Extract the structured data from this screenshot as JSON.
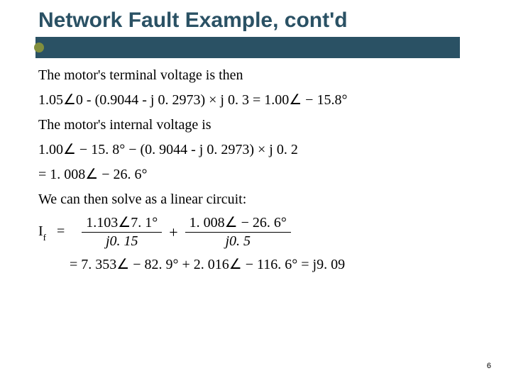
{
  "slide": {
    "title": "Network Fault Example, cont'd",
    "page_number": "6"
  },
  "body": {
    "line1": "The motor's terminal voltage is then",
    "eq1": "1.05∠0 - (0.9044  -  j 0. 2973) ×  j 0. 3 = 1.00∠ − 15.8°",
    "line2": "The motor's internal voltage is",
    "eq2a": "1.00∠ − 15. 8° − (0. 9044  -  j 0. 2973) ×  j 0. 2",
    "eq2b": "= 1. 008∠ − 26. 6°",
    "line3": "We can then solve as a linear circuit:",
    "if_label": "I",
    "if_sub": "f",
    "frac1_num": "1.103∠7. 1°",
    "frac1_den": "j0. 15",
    "frac2_num": "1. 008∠ − 26. 6°",
    "frac2_den": "j0. 5",
    "eq3b": "= 7. 353∠ − 82. 9° + 2. 016∠ − 116. 6° =  j9. 09"
  },
  "colors": {
    "accent_bar": "#2a5164",
    "title_text": "#2a5164",
    "bullet": "#818e3d"
  }
}
